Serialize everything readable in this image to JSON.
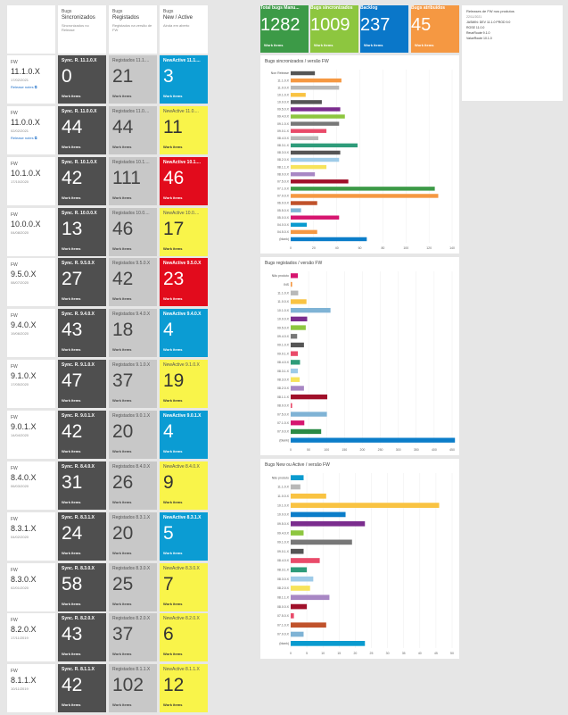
{
  "headers": [
    {
      "t1": "",
      "t2": "",
      "t3": ""
    },
    {
      "t1": "Bugs",
      "t2": "Sincronizados",
      "t3": "Sincronizados no Release"
    },
    {
      "t1": "Bugs",
      "t2": "Registados",
      "t3": "Registados na versão de FW"
    },
    {
      "t1": "Bugs",
      "t2": "New / Active",
      "t3": "Ainda em aberto"
    }
  ],
  "work_items_label": "Work items",
  "release_notes_label": "Release notes",
  "rows": [
    {
      "fw": "FW",
      "version": "11.1.0.X",
      "date": "17/02/2021",
      "notes": true,
      "sync_title": "Sync. R. 11.1.0.X",
      "sync": "0",
      "reg_title": "Registados 11.1....",
      "reg": "21",
      "act_title": "NewActive 11.1....",
      "act": "3",
      "act_color": "blue"
    },
    {
      "fw": "FW",
      "version": "11.0.0.X",
      "date": "02/02/2021",
      "notes": true,
      "sync_title": "Sync. R. 11.0.0.X",
      "sync": "44",
      "reg_title": "Registados 11.0....",
      "reg": "44",
      "act_title": "NewActive 11.0....",
      "act": "11",
      "act_color": "yellow"
    },
    {
      "fw": "FW",
      "version": "10.1.0.X",
      "date": "17/10/2020",
      "notes": false,
      "sync_title": "Sync. R. 10.1.0.X",
      "sync": "42",
      "reg_title": "Registados 10.1....",
      "reg": "111",
      "act_title": "NewActive 10.1....",
      "act": "46",
      "act_color": "red"
    },
    {
      "fw": "FW",
      "version": "10.0.0.X",
      "date": "04/08/2020",
      "notes": false,
      "sync_title": "Sync. R. 10.0.0.X",
      "sync": "13",
      "reg_title": "Registados 10.0....",
      "reg": "46",
      "act_title": "NewActive 10.0....",
      "act": "17",
      "act_color": "yellow"
    },
    {
      "fw": "FW",
      "version": "9.5.0.X",
      "date": "08/07/2020",
      "notes": false,
      "sync_title": "Sync. R. 9.5.0.X",
      "sync": "27",
      "reg_title": "Registados 9.5.0.X",
      "reg": "42",
      "act_title": "NewActive 9.5.0.X",
      "act": "23",
      "act_color": "red"
    },
    {
      "fw": "FW",
      "version": "9.4.0.X",
      "date": "19/06/2020",
      "notes": false,
      "sync_title": "Sync. R. 9.4.0.X",
      "sync": "43",
      "reg_title": "Registados 9.4.0.X",
      "reg": "18",
      "act_title": "NewActive 9.4.0.X",
      "act": "4",
      "act_color": "blue"
    },
    {
      "fw": "FW",
      "version": "9.1.0.X",
      "date": "17/05/2020",
      "notes": false,
      "sync_title": "Sync. R. 9.1.0.X",
      "sync": "47",
      "reg_title": "Registados 9.1.0.X",
      "reg": "37",
      "act_title": "NewActive 9.1.0.X",
      "act": "19",
      "act_color": "yellow"
    },
    {
      "fw": "FW",
      "version": "9.0.1.X",
      "date": "14/04/2020",
      "notes": false,
      "sync_title": "Sync. R. 9.0.1.X",
      "sync": "42",
      "reg_title": "Registados 9.0.1.X",
      "reg": "20",
      "act_title": "NewActive 9.0.1.X",
      "act": "4",
      "act_color": "blue"
    },
    {
      "fw": "FW",
      "version": "8.4.0.X",
      "date": "06/03/2020",
      "notes": false,
      "sync_title": "Sync. R. 8.4.0.X",
      "sync": "31",
      "reg_title": "Registados 8.4.0.X",
      "reg": "26",
      "act_title": "NewActive 8.4.0.X",
      "act": "9",
      "act_color": "yellow"
    },
    {
      "fw": "FW",
      "version": "8.3.1.X",
      "date": "04/02/2020",
      "notes": false,
      "sync_title": "Sync. R. 8.3.1.X",
      "sync": "24",
      "reg_title": "Registados 8.3.1.X",
      "reg": "20",
      "act_title": "NewActive 8.3.1.X",
      "act": "5",
      "act_color": "blue"
    },
    {
      "fw": "FW",
      "version": "8.3.0.X",
      "date": "02/01/2020",
      "notes": false,
      "sync_title": "Sync. R. 8.3.0.X",
      "sync": "58",
      "reg_title": "Registados 8.3.0.X",
      "reg": "25",
      "act_title": "NewActive 8.3.0.X",
      "act": "7",
      "act_color": "yellow"
    },
    {
      "fw": "FW",
      "version": "8.2.0.X",
      "date": "17/11/2019",
      "notes": false,
      "sync_title": "Sync. R. 8.2.0.X",
      "sync": "43",
      "reg_title": "Registados 8.2.0.X",
      "reg": "37",
      "act_title": "NewActive 8.2.0.X",
      "act": "6",
      "act_color": "yellow"
    },
    {
      "fw": "FW",
      "version": "8.1.1.X",
      "date": "10/11/2019",
      "notes": false,
      "sync_title": "Sync. R. 8.1.1.X",
      "sync": "42",
      "reg_title": "Registados 8.1.1.X",
      "reg": "102",
      "act_title": "NewActive 8.1.1.X",
      "act": "12",
      "act_color": "yellow"
    }
  ],
  "summary": [
    {
      "title": "Total bugs Manu...",
      "value": "1282",
      "color": "green"
    },
    {
      "title": "Bugs sincronizados",
      "value": "1009",
      "color": "lime"
    },
    {
      "title": "Backlog",
      "value": "237",
      "color": "azure"
    },
    {
      "title": "Bugs atribuídos",
      "value": "45",
      "color": "orange"
    }
  ],
  "releases_panel": {
    "title": "Releases de FW nos produtos",
    "date": "22/11/2021",
    "lines": [
      "JASMIN: DEV 11.1.0 PROD 9.0",
      "ROSE 11.0.0",
      "ReunRoute 9.1.0",
      "ValueRoute 10.1.0"
    ]
  },
  "chart_data": [
    {
      "type": "bar",
      "orientation": "horizontal",
      "title": "Bugs sincronizados / versão FW",
      "categories": [
        "Non Release",
        "11.1.0.X",
        "11.0.0.X",
        "10.1.0.X",
        "10.0.0.X",
        "09.5.0.X",
        "09.4.0.X",
        "09.1.0.X",
        "09.0.1.X",
        "08.4.0.X",
        "08.3.1.X",
        "08.3.0.X",
        "08.2.0.X",
        "08.1.1.X",
        "08.0.0.X",
        "07.5.0.X",
        "07.1.0.X",
        "07.0.0.X",
        "06.0.0.X",
        "05.5.0.X",
        "05.0.0.X",
        "04.0.0.X",
        "04.5.0.X",
        "(blank)"
      ],
      "values": [
        21,
        44,
        42,
        13,
        27,
        43,
        47,
        42,
        31,
        24,
        58,
        43,
        42,
        31,
        21,
        50,
        125,
        128,
        23,
        9,
        42,
        14,
        23,
        66
      ],
      "colors": [
        "#555555",
        "#f59842",
        "#b8b8b8",
        "#f9c342",
        "#555555",
        "#7b2d8e",
        "#8dc63f",
        "#777777",
        "#e94b6a",
        "#b8b8b8",
        "#2e9c7a",
        "#555555",
        "#9ecbe8",
        "#f7e35b",
        "#a887c4",
        "#a0102a",
        "#3c9a47",
        "#f59842",
        "#c0522b",
        "#7fb3d5",
        "#d6156f",
        "#0a9bcf",
        "#f59842",
        "#0b7dc9"
      ],
      "xlim": [
        0,
        140
      ],
      "ticks": [
        0,
        20,
        40,
        60,
        80,
        100,
        120,
        140
      ]
    },
    {
      "type": "bar",
      "orientation": "horizontal",
      "title": "Bugs registados / versão FW",
      "categories": [
        "Não produto",
        "INS",
        "11.1.0.X",
        "11.0.0.X",
        "10.1.0.X",
        "10.0.0.X",
        "09.5.0.X",
        "09.4.0.X",
        "09.1.0.X",
        "09.0.1.X",
        "08.4.0.X",
        "08.3.1.X",
        "08.3.0.X",
        "08.2.0.X",
        "08.1.1.X",
        "08.0.0.X",
        "07.5.0.X",
        "07.1.0.X",
        "07.0.0.X",
        "(blank)"
      ],
      "values": [
        20,
        4,
        21,
        44,
        111,
        46,
        42,
        18,
        37,
        20,
        26,
        20,
        25,
        37,
        102,
        4,
        101,
        38,
        85,
        458
      ],
      "colors": [
        "#d6156f",
        "#f59842",
        "#b8b8b8",
        "#f9c342",
        "#7fb3d5",
        "#7b2d8e",
        "#8dc63f",
        "#777777",
        "#555555",
        "#e94b6a",
        "#2e9c7a",
        "#9ecbe8",
        "#f7e35b",
        "#a887c4",
        "#a0102a",
        "#e94b6a",
        "#7fb3d5",
        "#d6156f",
        "#2a8a45",
        "#0b7dc9"
      ],
      "xlim": [
        0,
        450
      ],
      "ticks": [
        0,
        50,
        100,
        150,
        200,
        250,
        300,
        350,
        400,
        450
      ]
    },
    {
      "type": "bar",
      "orientation": "horizontal",
      "title": "Bugs New ou Active / versão FW",
      "categories": [
        "Não produto",
        "11.1.0.X",
        "11.0.0.X",
        "10.1.0.X",
        "10.0.0.X",
        "09.5.0.X",
        "09.4.0.X",
        "09.1.0.X",
        "09.0.1.X",
        "08.4.0.X",
        "08.3.1.X",
        "08.3.0.X",
        "08.2.0.X",
        "08.1.1.X",
        "08.0.0.X",
        "07.5.0.X",
        "07.1.0.X",
        "07.0.0.X",
        "(blank)"
      ],
      "values": [
        4,
        3,
        11,
        46,
        17,
        23,
        4,
        19,
        4,
        9,
        5,
        7,
        6,
        12,
        5,
        1,
        11,
        4,
        23
      ],
      "colors": [
        "#0a9bcf",
        "#b8b8b8",
        "#f9c342",
        "#f9c342",
        "#0b7dc9",
        "#7b2d8e",
        "#8dc63f",
        "#777777",
        "#555555",
        "#e94b6a",
        "#2e9c7a",
        "#9ecbe8",
        "#f7e35b",
        "#a887c4",
        "#a0102a",
        "#e94b6a",
        "#c0522b",
        "#7fb3d5",
        "#0a9bcf"
      ],
      "xlim": [
        0,
        50
      ],
      "ticks": [
        0,
        5,
        10,
        15,
        20,
        25,
        30,
        35,
        40,
        45,
        50
      ]
    }
  ]
}
